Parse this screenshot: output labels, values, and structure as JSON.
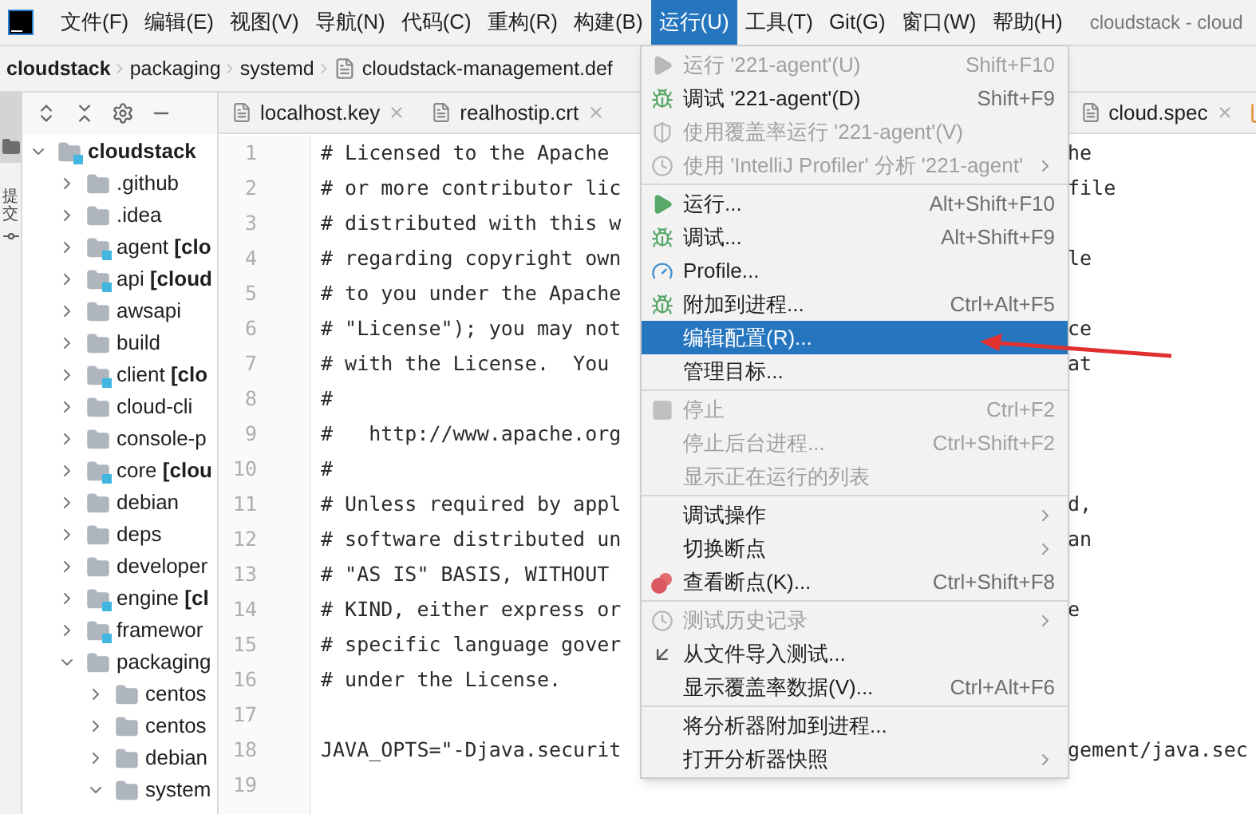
{
  "menubar": {
    "items": [
      {
        "label": "文件(F)",
        "selected": false
      },
      {
        "label": "编辑(E)",
        "selected": false
      },
      {
        "label": "视图(V)",
        "selected": false
      },
      {
        "label": "导航(N)",
        "selected": false
      },
      {
        "label": "代码(C)",
        "selected": false
      },
      {
        "label": "重构(R)",
        "selected": false
      },
      {
        "label": "构建(B)",
        "selected": false
      },
      {
        "label": "运行(U)",
        "selected": true
      },
      {
        "label": "工具(T)",
        "selected": false
      },
      {
        "label": "Git(G)",
        "selected": false
      },
      {
        "label": "窗口(W)",
        "selected": false
      },
      {
        "label": "帮助(H)",
        "selected": false
      }
    ],
    "title": "cloudstack - cloud"
  },
  "breadcrumb": [
    "cloudstack",
    "packaging",
    "systemd",
    "cloudstack-management.def"
  ],
  "side_strip": {
    "label": "提交"
  },
  "project_tree": [
    {
      "label": "cloudstack",
      "module": true,
      "expanded": true,
      "children": [
        {
          "label": ".github",
          "module": false,
          "expanded": false
        },
        {
          "label": ".idea",
          "module": false,
          "expanded": false
        },
        {
          "label": "agent **[clo**",
          "module": true,
          "expanded": false
        },
        {
          "label": "api **[cloud**",
          "module": true,
          "expanded": false
        },
        {
          "label": "awsapi",
          "module": false,
          "expanded": false
        },
        {
          "label": "build",
          "module": false,
          "expanded": false
        },
        {
          "label": "client **[clo**",
          "module": true,
          "expanded": false
        },
        {
          "label": "cloud-cli",
          "module": false,
          "expanded": false
        },
        {
          "label": "console-p",
          "module": false,
          "expanded": false
        },
        {
          "label": "core **[clou**",
          "module": true,
          "expanded": false
        },
        {
          "label": "debian",
          "module": false,
          "expanded": false
        },
        {
          "label": "deps",
          "module": false,
          "expanded": false
        },
        {
          "label": "developer",
          "module": false,
          "expanded": false
        },
        {
          "label": "engine **[cl**",
          "module": true,
          "expanded": false
        },
        {
          "label": "framewor",
          "module": true,
          "expanded": false
        },
        {
          "label": "packaging",
          "module": false,
          "expanded": true,
          "children": [
            {
              "label": "centos",
              "module": false,
              "expanded": false
            },
            {
              "label": "centos",
              "module": false,
              "expanded": false
            },
            {
              "label": "debian",
              "module": false,
              "expanded": false
            },
            {
              "label": "system",
              "module": false,
              "expanded": true
            }
          ]
        }
      ]
    }
  ],
  "editor_tabs": [
    {
      "label": "localhost.key",
      "selected": false
    },
    {
      "label": "realhostip.crt",
      "selected": false
    },
    {
      "label": "cloud.spec",
      "selected": false
    }
  ],
  "code_lines": [
    {
      "number": "1",
      "text": "# Licensed to the Apache",
      "tail": "he"
    },
    {
      "number": "2",
      "text": "# or more contributor lic",
      "tail": "file"
    },
    {
      "number": "3",
      "text": "# distributed with this w"
    },
    {
      "number": "4",
      "text": "# regarding copyright own",
      "tail": "le"
    },
    {
      "number": "5",
      "text": "# to you under the Apache"
    },
    {
      "number": "6",
      "text": "# \"License\"); you may not",
      "tail": "ce"
    },
    {
      "number": "7",
      "text": "# with the License.  You",
      "tail": "at"
    },
    {
      "number": "8",
      "text": "#"
    },
    {
      "number": "9",
      "text": "#   http://www.apache.org"
    },
    {
      "number": "10",
      "text": "#"
    },
    {
      "number": "11",
      "text": "# Unless required by appl",
      "tail": "d,"
    },
    {
      "number": "12",
      "text": "# software distributed un",
      "tail": "an"
    },
    {
      "number": "13",
      "text": "# \"AS IS\" BASIS, WITHOUT"
    },
    {
      "number": "14",
      "text": "# KIND, either express or",
      "tail": "e"
    },
    {
      "number": "15",
      "text": "# specific language gover"
    },
    {
      "number": "16",
      "text": "# under the License."
    },
    {
      "number": "17"
    },
    {
      "number": "18",
      "text": "JAVA_OPTS=\"-Djava.securit",
      "tail": "gement/java.sec"
    },
    {
      "number": "19"
    }
  ],
  "run_menu": {
    "groups": [
      [
        {
          "label": "运行 '221-agent'(U)",
          "shortcut": "Shift+F10",
          "disabled": true,
          "selected": false,
          "submenu": false
        },
        {
          "label": "调试 '221-agent'(D)",
          "shortcut": "Shift+F9",
          "disabled": false,
          "selected": false,
          "submenu": false
        },
        {
          "label": "使用覆盖率运行 '221-agent'(V)",
          "disabled": true,
          "selected": false,
          "submenu": false
        },
        {
          "label": "使用 'IntelliJ Profiler' 分析  '221-agent'",
          "disabled": true,
          "selected": false,
          "submenu": true
        }
      ],
      [
        {
          "label": "运行...",
          "shortcut": "Alt+Shift+F10",
          "disabled": false,
          "selected": false,
          "submenu": false
        },
        {
          "label": "调试...",
          "shortcut": "Alt+Shift+F9",
          "disabled": false,
          "selected": false,
          "submenu": false
        },
        {
          "label": "Profile...",
          "disabled": false,
          "selected": false,
          "submenu": false
        },
        {
          "label": "附加到进程...",
          "shortcut": "Ctrl+Alt+F5",
          "disabled": false,
          "selected": false,
          "submenu": false
        },
        {
          "label": "编辑配置(R)...",
          "disabled": false,
          "selected": true,
          "submenu": false
        },
        {
          "label": "管理目标...",
          "disabled": false,
          "selected": false,
          "submenu": false
        }
      ],
      [
        {
          "label": "停止",
          "shortcut": "Ctrl+F2",
          "disabled": true,
          "selected": false,
          "submenu": false
        },
        {
          "label": "停止后台进程...",
          "shortcut": "Ctrl+Shift+F2",
          "disabled": true,
          "selected": false,
          "submenu": false
        },
        {
          "label": "显示正在运行的列表",
          "disabled": true,
          "selected": false,
          "submenu": false
        }
      ],
      [
        {
          "label": "调试操作",
          "disabled": false,
          "selected": false,
          "submenu": true
        },
        {
          "label": "切换断点",
          "disabled": false,
          "selected": false,
          "submenu": true
        },
        {
          "label": "查看断点(K)...",
          "shortcut": "Ctrl+Shift+F8",
          "disabled": false,
          "selected": false,
          "submenu": false
        }
      ],
      [
        {
          "label": "测试历史记录",
          "disabled": true,
          "selected": false,
          "submenu": true
        },
        {
          "label": "从文件导入测试...",
          "disabled": false,
          "selected": false,
          "submenu": false
        },
        {
          "label": "显示覆盖率数据(V)...",
          "shortcut": "Ctrl+Alt+F6",
          "disabled": false,
          "selected": false,
          "submenu": false
        }
      ],
      [
        {
          "label": "将分析器附加到进程...",
          "disabled": false,
          "selected": false,
          "submenu": false
        },
        {
          "label": "打开分析器快照",
          "disabled": false,
          "selected": false,
          "submenu": true
        }
      ]
    ]
  }
}
